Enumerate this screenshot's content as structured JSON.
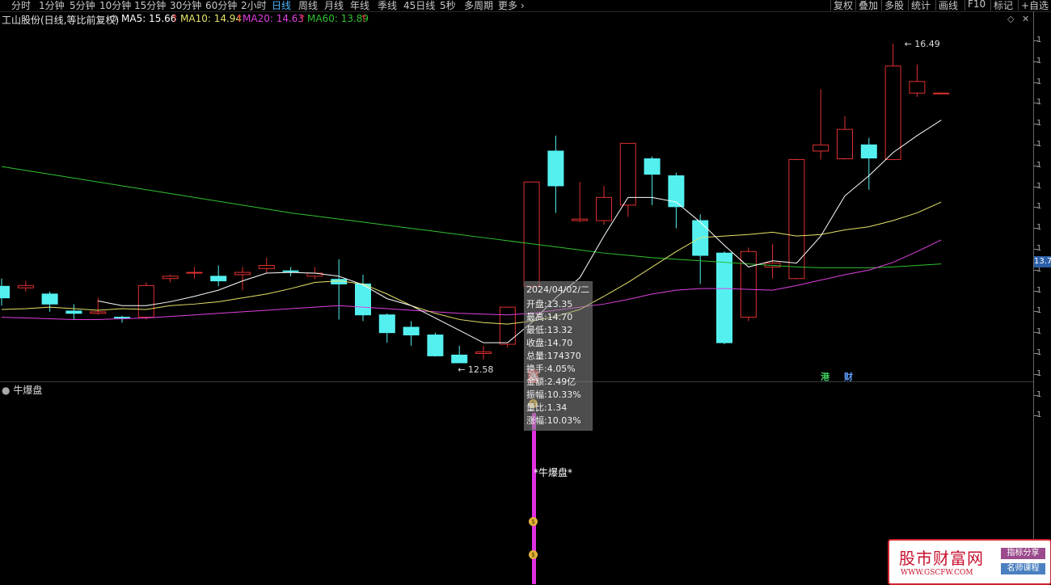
{
  "toolbar": {
    "periods": [
      "分时",
      "1分钟",
      "5分钟",
      "10分钟",
      "15分钟",
      "30分钟",
      "60分钟",
      "2小时",
      "日线",
      "周线",
      "月线",
      "年线",
      "季线",
      "45日线",
      "5秒",
      "多周期",
      "更多"
    ],
    "active_period": "日线",
    "right_buttons": [
      "复权",
      "叠加",
      "多股",
      "统计",
      "画线",
      "F10",
      "标记",
      "+自选"
    ]
  },
  "info": {
    "stock": "工山股份(日线,等比前复权)",
    "ma5": "MA5: 15.66",
    "ma10": "MA10: 14.94",
    "ma20": "MA20: 14.63",
    "ma60": "MA60: 13.89",
    "arrow": "↑",
    "colors": {
      "ma5": "#ffffff",
      "ma10": "#e6e36a",
      "ma20": "#e040e0",
      "ma60": "#30c030",
      "up": "#e03030",
      "down": "#54f0f0"
    }
  },
  "axis": {
    "tick_label": "1",
    "current_price": "13.7"
  },
  "annotations": {
    "high": "16.49",
    "low": "12.58"
  },
  "tooltip": {
    "date": "2024/04/02/二",
    "open": "开盘:13.35",
    "high": "最高:14.70",
    "low": "最低:13.32",
    "close": "收盘:14.70",
    "volume": "总量:174370",
    "turnover": "换手:4.05%",
    "amount": "金额:2.49亿",
    "amplitude": "振幅:10.33%",
    "ratio": "量比:1.34",
    "change": "涨幅:10.03%"
  },
  "badges": {
    "zhang": "涨",
    "gang": "港",
    "cai": "财"
  },
  "sub": {
    "indicator": "牛爆盘",
    "signal": "*牛爆盘*",
    "coin": "$"
  },
  "watermark": {
    "title": "股市财富网",
    "url": "WWW.GSCFW.COM",
    "tag1": "指标分享",
    "tag2": "名师课程"
  },
  "chart_data": {
    "type": "candlestick",
    "candles": [
      {
        "o": 13.35,
        "c": 13.2,
        "h": 13.45,
        "l": 13.1
      },
      {
        "o": 13.33,
        "c": 13.36,
        "h": 13.42,
        "l": 13.28
      },
      {
        "o": 13.25,
        "c": 13.12,
        "h": 13.28,
        "l": 13.02
      },
      {
        "o": 13.03,
        "c": 13.0,
        "h": 13.12,
        "l": 12.92
      },
      {
        "o": 13.0,
        "c": 13.02,
        "h": 13.2,
        "l": 12.98
      },
      {
        "o": 12.95,
        "c": 12.94,
        "h": 12.97,
        "l": 12.88
      },
      {
        "o": 12.95,
        "c": 13.36,
        "h": 13.4,
        "l": 12.92
      },
      {
        "o": 13.45,
        "c": 13.48,
        "h": 13.5,
        "l": 13.4
      },
      {
        "o": 13.52,
        "c": 13.53,
        "h": 13.6,
        "l": 13.45
      },
      {
        "o": 13.48,
        "c": 13.42,
        "h": 13.62,
        "l": 13.35
      },
      {
        "o": 13.5,
        "c": 13.53,
        "h": 13.6,
        "l": 13.3
      },
      {
        "o": 13.58,
        "c": 13.62,
        "h": 13.72,
        "l": 13.52
      },
      {
        "o": 13.55,
        "c": 13.54,
        "h": 13.6,
        "l": 13.48
      },
      {
        "o": 13.48,
        "c": 13.52,
        "h": 13.6,
        "l": 13.44
      },
      {
        "o": 13.44,
        "c": 13.38,
        "h": 13.7,
        "l": 12.92
      },
      {
        "o": 13.38,
        "c": 12.98,
        "h": 13.5,
        "l": 12.9
      },
      {
        "o": 12.98,
        "c": 12.75,
        "h": 13.0,
        "l": 12.62
      },
      {
        "o": 12.82,
        "c": 12.72,
        "h": 12.9,
        "l": 12.58
      },
      {
        "o": 12.72,
        "c": 12.45,
        "h": 12.75,
        "l": 12.44
      },
      {
        "o": 12.46,
        "c": 12.36,
        "h": 12.58,
        "l": 12.36
      },
      {
        "o": 12.48,
        "c": 12.5,
        "h": 12.58,
        "l": 12.4
      },
      {
        "o": 12.6,
        "c": 13.08,
        "h": 13.08,
        "l": 12.56
      },
      {
        "o": 13.35,
        "c": 14.7,
        "h": 14.7,
        "l": 13.32
      },
      {
        "o": 15.1,
        "c": 14.65,
        "h": 15.3,
        "l": 14.3
      },
      {
        "o": 14.2,
        "c": 14.22,
        "h": 14.7,
        "l": 14.18
      },
      {
        "o": 14.2,
        "c": 14.5,
        "h": 14.65,
        "l": 14.15
      },
      {
        "o": 14.4,
        "c": 15.2,
        "h": 15.2,
        "l": 14.25
      },
      {
        "o": 15.0,
        "c": 14.8,
        "h": 15.03,
        "l": 14.4
      },
      {
        "o": 14.78,
        "c": 14.38,
        "h": 14.82,
        "l": 14.1
      },
      {
        "o": 14.2,
        "c": 13.75,
        "h": 14.28,
        "l": 13.38
      },
      {
        "o": 13.78,
        "c": 12.62,
        "h": 13.8,
        "l": 12.6
      },
      {
        "o": 12.95,
        "c": 13.8,
        "h": 13.85,
        "l": 12.9
      },
      {
        "o": 13.6,
        "c": 13.65,
        "h": 13.9,
        "l": 13.45
      },
      {
        "o": 13.45,
        "c": 14.99,
        "h": 15.0,
        "l": 13.44
      },
      {
        "o": 15.1,
        "c": 15.18,
        "h": 15.9,
        "l": 14.99
      },
      {
        "o": 15.0,
        "c": 15.38,
        "h": 15.55,
        "l": 14.99
      },
      {
        "o": 15.18,
        "c": 15.01,
        "h": 15.27,
        "l": 14.6
      },
      {
        "o": 14.99,
        "c": 16.2,
        "h": 16.49,
        "l": 14.99
      },
      {
        "o": 15.85,
        "c": 16.0,
        "h": 16.22,
        "l": 15.8
      },
      {
        "o": 15.85,
        "c": 15.85,
        "h": 15.86,
        "l": 15.84
      }
    ],
    "ma5": [
      null,
      null,
      null,
      null,
      13.16,
      13.1,
      13.1,
      13.15,
      13.22,
      13.3,
      13.42,
      13.52,
      13.53,
      13.52,
      13.48,
      13.37,
      13.19,
      13.1,
      12.94,
      12.78,
      12.62,
      12.62,
      12.88,
      13.2,
      13.46,
      14.0,
      14.5,
      14.5,
      14.44,
      14.18,
      13.88,
      13.6,
      13.68,
      13.65,
      14.0,
      14.52,
      14.78,
      15.08,
      15.3,
      15.5
    ],
    "ma10": [
      13.05,
      13.06,
      13.08,
      13.06,
      13.04,
      13.06,
      13.05,
      13.1,
      13.12,
      13.15,
      13.2,
      13.25,
      13.32,
      13.4,
      13.42,
      13.38,
      13.25,
      13.1,
      13.0,
      12.92,
      12.88,
      12.86,
      12.9,
      12.96,
      13.05,
      13.22,
      13.4,
      13.6,
      13.8,
      13.98,
      14.0,
      14.02,
      14.05,
      14.0,
      14.02,
      14.08,
      14.12,
      14.2,
      14.3,
      14.44
    ],
    "ma20": [
      12.95,
      12.94,
      12.93,
      12.92,
      12.92,
      12.93,
      12.94,
      12.96,
      12.98,
      13.0,
      13.02,
      13.04,
      13.06,
      13.08,
      13.1,
      13.08,
      13.06,
      13.04,
      13.02,
      13.0,
      12.99,
      12.98,
      13.0,
      13.04,
      13.08,
      13.12,
      13.18,
      13.25,
      13.3,
      13.32,
      13.32,
      13.31,
      13.3,
      13.36,
      13.43,
      13.5,
      13.56,
      13.66,
      13.8,
      13.95
    ],
    "ma60": [
      14.9,
      14.85,
      14.8,
      14.75,
      14.7,
      14.65,
      14.6,
      14.55,
      14.5,
      14.45,
      14.4,
      14.35,
      14.3,
      14.26,
      14.22,
      14.18,
      14.14,
      14.1,
      14.06,
      14.02,
      13.98,
      13.94,
      13.9,
      13.86,
      13.82,
      13.78,
      13.75,
      13.72,
      13.7,
      13.68,
      13.66,
      13.64,
      13.62,
      13.6,
      13.59,
      13.59,
      13.59,
      13.6,
      13.62,
      13.64
    ]
  }
}
